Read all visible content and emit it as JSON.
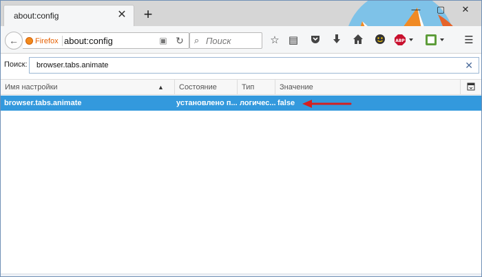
{
  "browser": {
    "tab_title": "about:config",
    "identity_label": "Firefox",
    "url": "about:config",
    "search_placeholder": "Поиск",
    "toolbar_icons": [
      "bookmark-star-icon",
      "reading-list-icon",
      "pocket-icon",
      "download-icon",
      "home-icon",
      "emoji-addon-icon",
      "adblock-plus-icon",
      "translate-addon-icon",
      "hamburger-menu-icon"
    ],
    "adblock_label": "ABP"
  },
  "config": {
    "search_label": "Поиск:",
    "search_value": "browser.tabs.animate",
    "columns": {
      "name": "Имя настройки",
      "status": "Состояние",
      "type": "Тип",
      "value": "Значение"
    },
    "rows": [
      {
        "name": "browser.tabs.animate",
        "status": "установлено п...",
        "type": "логичес...",
        "value": "false"
      }
    ]
  },
  "colors": {
    "selection": "#3399dd",
    "annotation_arrow": "#d42020",
    "accent": "#e66000"
  }
}
